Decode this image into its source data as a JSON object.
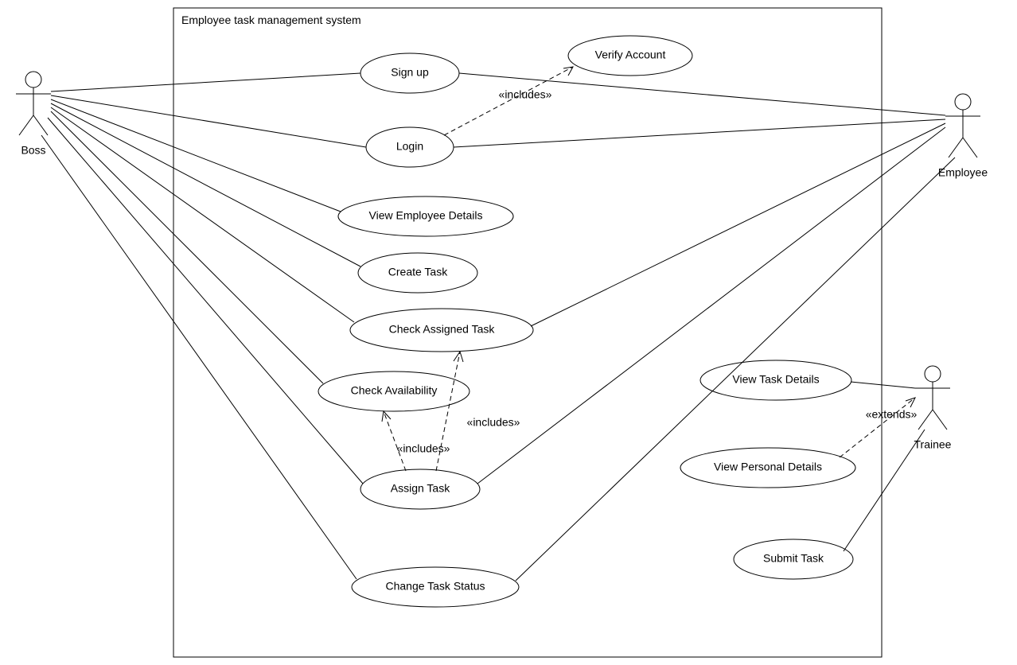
{
  "system_title": "Employee task management system",
  "actors": {
    "boss": "Boss",
    "employee": "Employee",
    "trainee": "Trainee"
  },
  "usecases": {
    "signup": "Sign up",
    "verify": "Verify Account",
    "login": "Login",
    "view_emp": "View Employee Details",
    "create_task": "Create Task",
    "check_assigned": "Check Assigned Task",
    "check_avail": "Check Availability",
    "assign_task": "Assign Task",
    "change_status": "Change Task Status",
    "view_task_details": "View Task Details",
    "view_personal": "View Personal Details",
    "submit_task": "Submit Task"
  },
  "stereotypes": {
    "includes1": "«includes»",
    "includes2": "«includes»",
    "includes3": "«includes»",
    "extends1": "«extends»"
  }
}
